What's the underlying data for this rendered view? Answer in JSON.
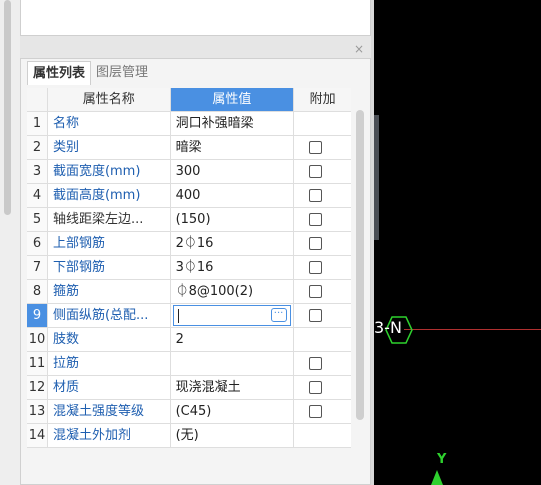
{
  "tabs": {
    "properties": "属性列表",
    "layers": "图层管理"
  },
  "table": {
    "header": {
      "name": "属性名称",
      "value": "属性值",
      "add": "附加"
    },
    "rows": [
      {
        "num": "1",
        "name": "名称",
        "value": "洞口补强暗梁",
        "checkbox": false
      },
      {
        "num": "2",
        "name": "类别",
        "value": "暗梁",
        "checkbox": true
      },
      {
        "num": "3",
        "name": "截面宽度(mm)",
        "value": "300",
        "checkbox": true
      },
      {
        "num": "4",
        "name": "截面高度(mm)",
        "value": "400",
        "checkbox": true
      },
      {
        "num": "5",
        "name": "轴线距梁左边...",
        "value": "(150)",
        "checkbox": true
      },
      {
        "num": "6",
        "name": "上部钢筋",
        "value": "2⏀16",
        "checkbox": true
      },
      {
        "num": "7",
        "name": "下部钢筋",
        "value": "3⏀16",
        "checkbox": true
      },
      {
        "num": "8",
        "name": "箍筋",
        "value": "⏀8@100(2)",
        "checkbox": true
      },
      {
        "num": "9",
        "name": "侧面纵筋(总配...",
        "value": "",
        "checkbox": true,
        "selected": true
      },
      {
        "num": "10",
        "name": "肢数",
        "value": "2",
        "checkbox": false
      },
      {
        "num": "11",
        "name": "拉筋",
        "value": "",
        "checkbox": true
      },
      {
        "num": "12",
        "name": "材质",
        "value": "现浇混凝土",
        "checkbox": true
      },
      {
        "num": "13",
        "name": "混凝土强度等级",
        "value": "(C45)",
        "checkbox": true
      },
      {
        "num": "14",
        "name": "混凝土外加剂",
        "value": "(无)",
        "checkbox": false
      }
    ]
  },
  "canvas": {
    "grid_label": "3-N",
    "axis_label": "Y"
  },
  "icons": {
    "close": "close-icon",
    "ellipsis": "ellipsis-icon"
  },
  "colors": {
    "accent": "#4a90e2",
    "link": "#1f5fb0",
    "canvas_bg": "#000000",
    "axis": "#2ed12e",
    "grid_line": "#b03030"
  }
}
